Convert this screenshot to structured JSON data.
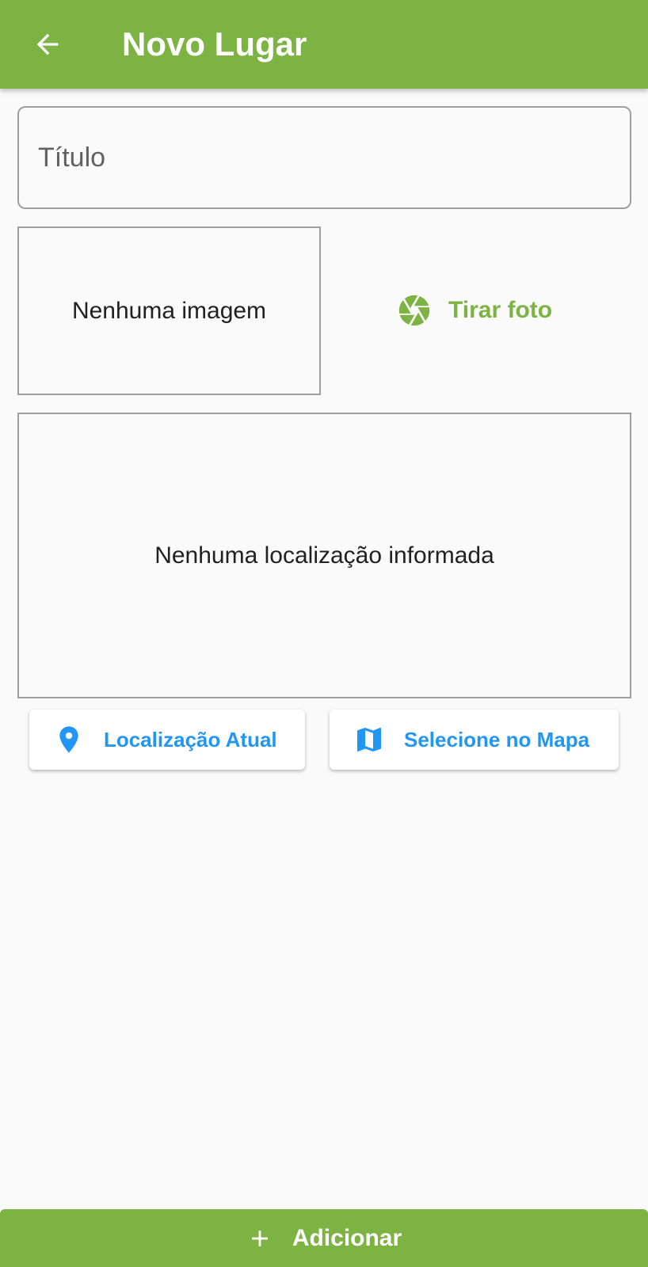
{
  "appbar": {
    "title": "Novo Lugar",
    "back_icon": "arrow-back-icon",
    "color": "#7cb342"
  },
  "form": {
    "title_placeholder": "Título",
    "title_value": ""
  },
  "image_preview": {
    "text": "Nenhuma imagem"
  },
  "photo_button": {
    "label": "Tirar foto",
    "icon": "camera-shutter-icon",
    "color": "#7cb342"
  },
  "location_preview": {
    "text": "Nenhuma localização informada"
  },
  "location_buttons": {
    "current": {
      "label": "Localização Atual",
      "icon": "location-pin-icon"
    },
    "map": {
      "label": "Selecione no Mapa",
      "icon": "map-icon"
    },
    "color": "#2196f3"
  },
  "add_button": {
    "label": "Adicionar",
    "icon": "plus-icon",
    "color": "#7cb342"
  }
}
